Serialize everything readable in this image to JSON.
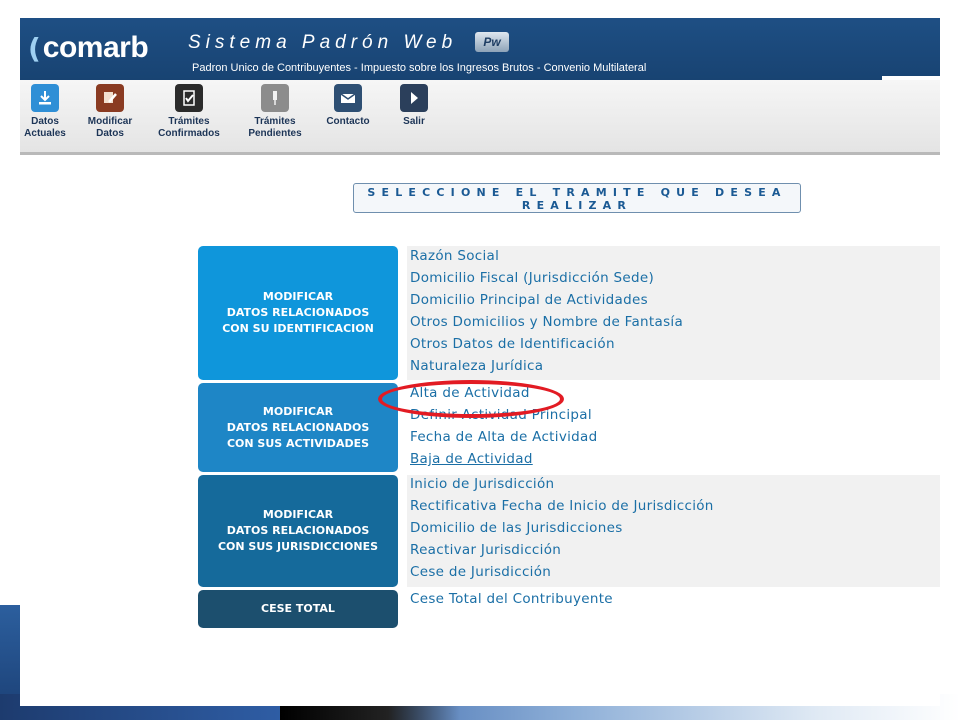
{
  "header": {
    "logo_text": "comarb",
    "system_title": "Sistema Padrón Web",
    "badge": "Pw",
    "subtitle": "Padron Unico de Contribuyentes - Impuesto sobre los Ingresos Brutos - Convenio Multilateral"
  },
  "toolbar": [
    {
      "label": "Datos\nActuales",
      "icon": "download-icon",
      "color": "#2f8fd6"
    },
    {
      "label": "Modificar\nDatos",
      "icon": "edit-hand-icon",
      "color": "#8a3b22"
    },
    {
      "label": "Trámites\nConfirmados",
      "icon": "confirmed-document-icon",
      "color": "#2b2b2b"
    },
    {
      "label": "Trámites\nPendientes",
      "icon": "pending-pin-icon",
      "color": "#8c8c8c"
    },
    {
      "label": "Contacto",
      "icon": "mail-icon",
      "color": "#2e4f73"
    },
    {
      "label": "Salir",
      "icon": "exit-icon",
      "color": "#2b3f5b"
    }
  ],
  "select_prompt": "SELECCIONE EL TRAMITE QUE DESEA REALIZAR",
  "categories": [
    {
      "label": "MODIFICAR\nDATOS RELACIONADOS\nCON SU IDENTIFICACION",
      "color": "#0f96db"
    },
    {
      "label": "MODIFICAR\nDATOS RELACIONADOS\nCON SUS ACTIVIDADES",
      "color": "#1e86c6"
    },
    {
      "label": "MODIFICAR\nDATOS RELACIONADOS\nCON SUS JURISDICCIONES",
      "color": "#156a9b"
    },
    {
      "label": "CESE TOTAL",
      "color": "#1c4f6e"
    }
  ],
  "options": {
    "identificacion": [
      "Razón Social",
      "Domicilio Fiscal (Jurisdicción Sede)",
      "Domicilio Principal de Actividades",
      "Otros Domicilios y Nombre de Fantasía",
      "Otros Datos de Identificación",
      "Naturaleza Jurídica"
    ],
    "actividades": [
      "Alta de Actividad",
      "Definir Actividad Principal",
      "Fecha de Alta de Actividad",
      "Baja de Actividad"
    ],
    "jurisdicciones": [
      "Inicio de Jurisdicción",
      "Rectificativa Fecha de Inicio de Jurisdicción",
      "Domicilio de las Jurisdicciones",
      "Reactivar Jurisdicción",
      "Cese de Jurisdicción"
    ],
    "cese": [
      "Cese Total del Contribuyente"
    ]
  },
  "annotation_color": "#e21b23"
}
